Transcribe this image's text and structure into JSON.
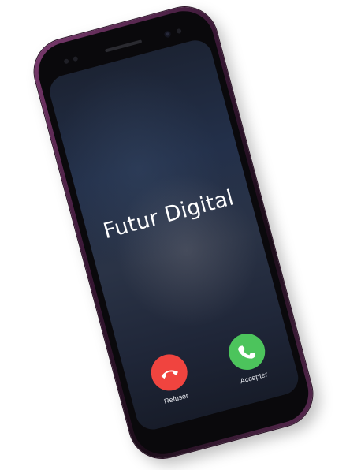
{
  "caller": {
    "name": "Futur Digital"
  },
  "actions": {
    "decline_label": "Refuser",
    "accept_label": "Accepter"
  },
  "icons": {
    "decline": "phone-hangup-icon",
    "accept": "phone-answer-icon"
  },
  "colors": {
    "decline": "#f0443f",
    "accept": "#4cc45c",
    "phone_frame": "#5a2a52"
  }
}
